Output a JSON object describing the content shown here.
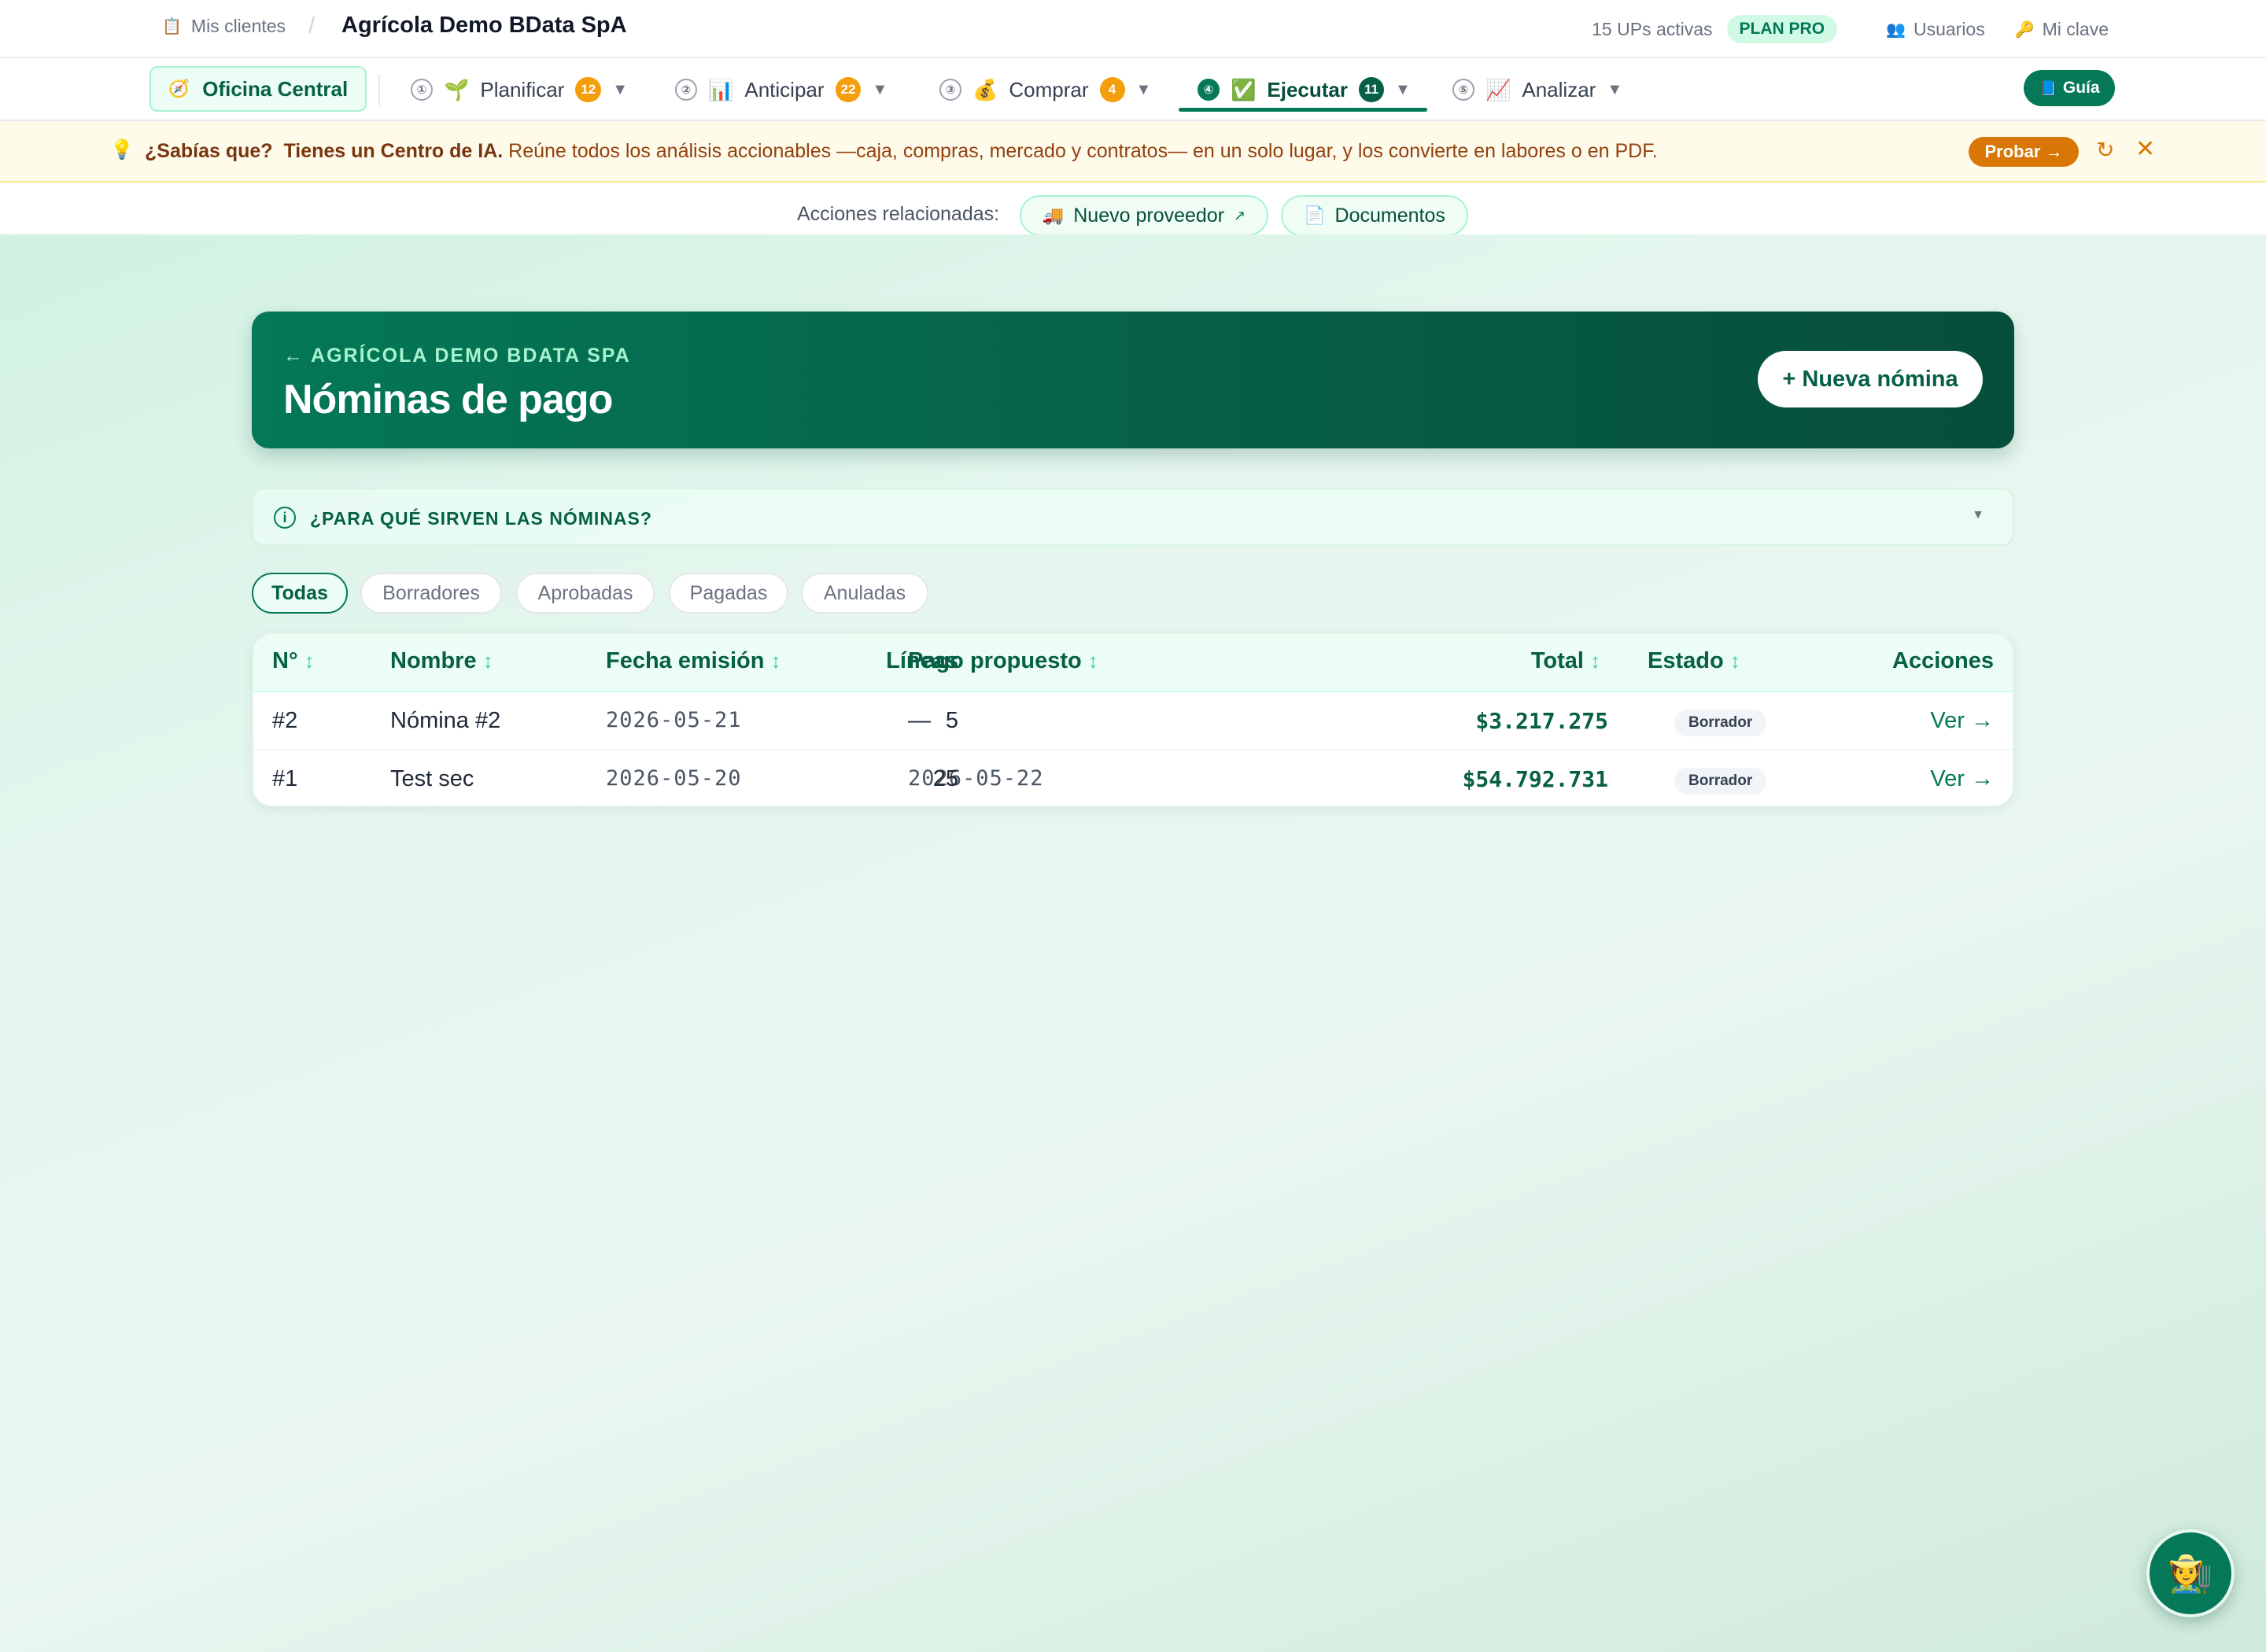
{
  "topbar": {
    "clients_icon": "clipboard-icon",
    "clients_link": "Mis clientes",
    "separator": "/",
    "client_name": "Agrícola Demo BData SpA",
    "ups_active": "15 UPs activas",
    "plan": "PLAN PRO",
    "users_icon": "users-icon",
    "users": "Usuarios",
    "key_icon": "key-icon",
    "password": "Mi clave"
  },
  "nav": {
    "office": "Oficina Central",
    "office_icon": "compass-icon",
    "items": [
      {
        "step": "①",
        "icon": "🌱",
        "label": "Planificar",
        "badge": "12"
      },
      {
        "step": "②",
        "icon": "📊",
        "label": "Anticipar",
        "badge": "22"
      },
      {
        "step": "③",
        "icon": "💰",
        "label": "Comprar",
        "badge": "4"
      },
      {
        "step": "④",
        "icon": "✅",
        "label": "Ejecutar",
        "badge": "11"
      },
      {
        "step": "⑤",
        "icon": "📈",
        "label": "Analizar"
      }
    ],
    "caret": "▼",
    "guide": "Guía",
    "guide_icon": "book-icon"
  },
  "tip": {
    "icon": "lightbulb-icon",
    "lead": "¿Sabías que?",
    "headline": "Tienes un Centro de IA.",
    "body": "Reúne todos los análisis accionables —caja, compras, mercado y contratos— en un solo lugar, y los convierte en labores o en PDF.",
    "cta": "Probar →",
    "reload": "↻",
    "close": "✕"
  },
  "related": {
    "label": "Acciones relacionadas:",
    "actions": [
      {
        "icon": "🚚",
        "label": "Nuevo proveedor",
        "suffix": "↗"
      },
      {
        "icon": "📄",
        "label": "Documentos"
      }
    ]
  },
  "hero": {
    "back": "← AGRÍCOLA DEMO BDATA SPA",
    "title": "Nóminas de pago",
    "new_button": "+ Nueva nómina"
  },
  "info": {
    "icon": "ⓘ",
    "text": "¿PARA QUÉ SIRVEN LAS NÓMINAS?",
    "chevron": "▼"
  },
  "filters": [
    "Todas",
    "Borradores",
    "Aprobadas",
    "Pagadas",
    "Anuladas"
  ],
  "filters_active": "Todas",
  "table": {
    "headers": {
      "number": "N°",
      "name": "Nombre",
      "issue_date": "Fecha emisión",
      "proposed_payment": "Pago propuesto",
      "lines": "Líneas",
      "total": "Total",
      "status": "Estado",
      "actions": "Acciones"
    },
    "sort_icon": "↕",
    "rows": [
      {
        "number": "#2",
        "name": "Nómina #2",
        "issue_date": "2026-05-21",
        "proposed_payment": "—",
        "lines": "5",
        "total": "$3.217.275",
        "status": "Borrador",
        "action": "Ver →"
      },
      {
        "number": "#1",
        "name": "Test sec",
        "issue_date": "2026-05-20",
        "proposed_payment": "2026-05-22",
        "lines": "25",
        "total": "$54.792.731",
        "status": "Borrador",
        "action": "Ver →"
      }
    ]
  },
  "assistant_fab": {
    "icon": "farmer-icon",
    "glyph": "🧑‍🌾"
  },
  "colors": {
    "primary": "#047857",
    "primary_dark": "#064e3b",
    "badge": "#f59e0b",
    "tip_background": "#fffbeb",
    "tip_cta": "#d97706"
  }
}
